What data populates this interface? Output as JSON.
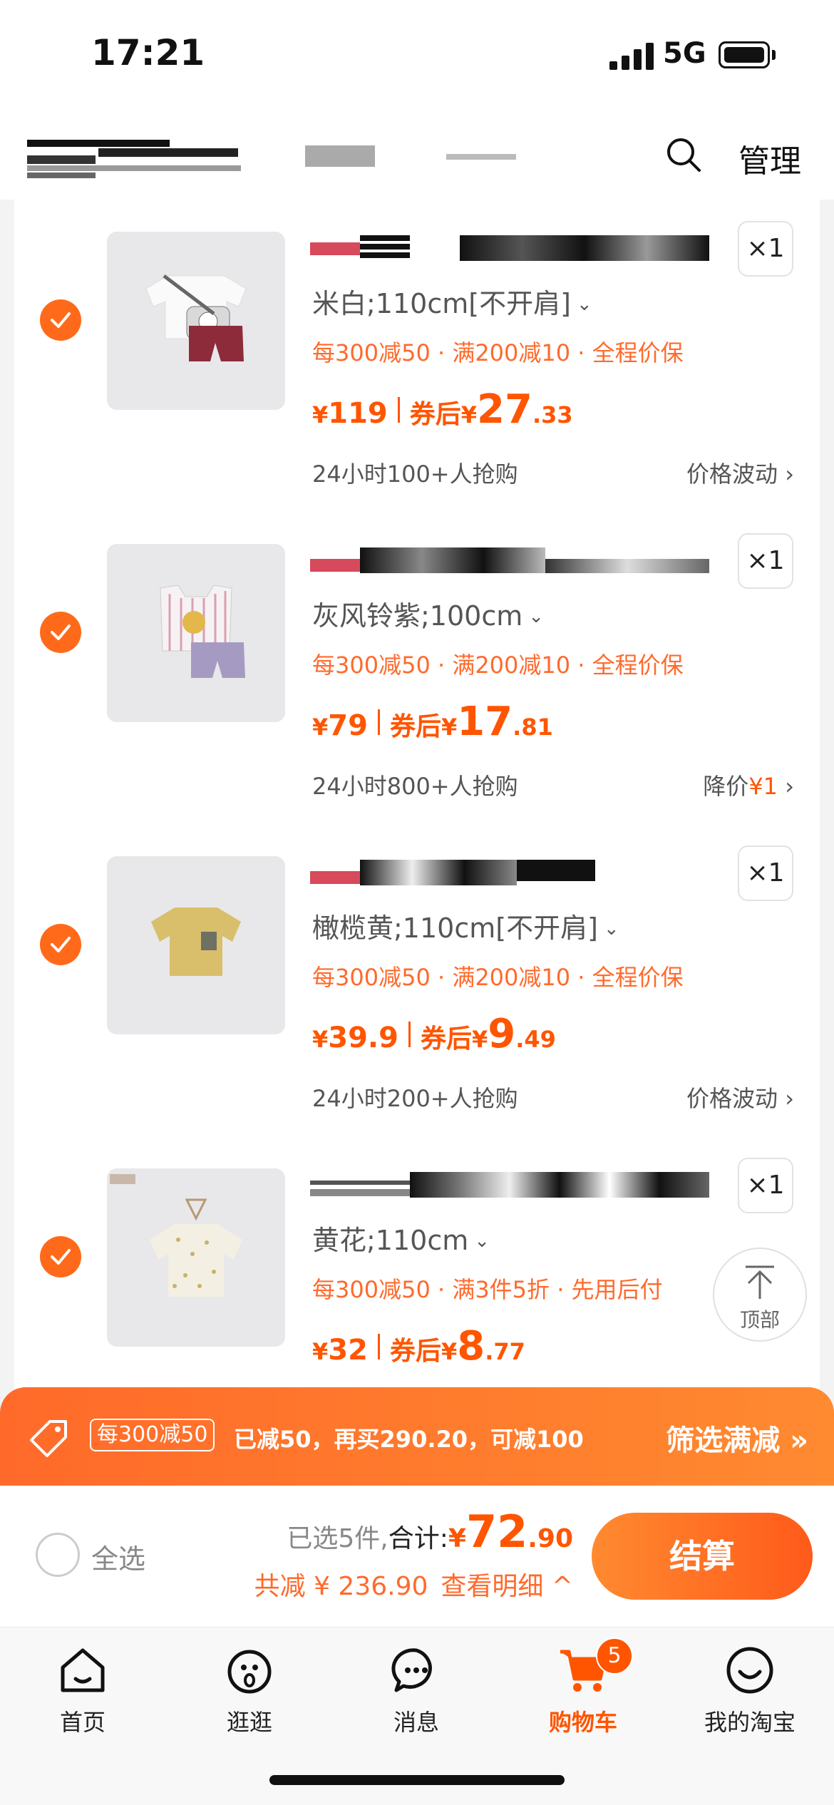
{
  "status": {
    "time": "17:21",
    "network": "5G"
  },
  "nav": {
    "manage_label": "管理"
  },
  "items": [
    {
      "variant": "米白;110cm[不开肩]",
      "promo": "每300减50 · 满200减10 · 全程价保",
      "price": "119",
      "coupon_label": "券后",
      "after_int": "27",
      "after_dec": ".33",
      "hot": "24小时100+人抢购",
      "trend": "价格波动",
      "trend_extra": "",
      "qty": "×1"
    },
    {
      "variant": "灰风铃紫;100cm",
      "promo": "每300减50 · 满200减10 · 全程价保",
      "price": "79",
      "coupon_label": "券后",
      "after_int": "17",
      "after_dec": ".81",
      "hot": "24小时800+人抢购",
      "trend": "降价",
      "trend_extra": "¥1",
      "qty": "×1"
    },
    {
      "variant": "橄榄黄;110cm[不开肩]",
      "promo": "每300减50 · 满200减10 · 全程价保",
      "price": "39.9",
      "coupon_label": "券后",
      "after_int": "9",
      "after_dec": ".49",
      "hot": "24小时200+人抢购",
      "trend": "价格波动",
      "trend_extra": "",
      "qty": "×1"
    },
    {
      "variant": "黄花;110cm",
      "promo": "每300减50 · 满3件5折 · 先用后付",
      "price": "32",
      "coupon_label": "券后",
      "after_int": "8",
      "after_dec": ".77",
      "hot": "",
      "trend": "",
      "trend_extra": "",
      "qty": "×1"
    }
  ],
  "currency": "¥",
  "back_to_top": "顶部",
  "promo_bar": {
    "chip": "每300减50",
    "text": "已减50，再买290.20，可减100",
    "filter": "筛选满减 »"
  },
  "checkout": {
    "select_all": "全选",
    "selected": "已选5件,",
    "total_label": "合计:",
    "total_int": "72",
    "total_dec": ".90",
    "saved": "共减 ¥ 236.90",
    "detail": "查看明细 ^",
    "button": "结算"
  },
  "tabs": [
    {
      "label": "首页",
      "icon": "home-icon"
    },
    {
      "label": "逛逛",
      "icon": "browse-icon"
    },
    {
      "label": "消息",
      "icon": "message-icon"
    },
    {
      "label": "购物车",
      "icon": "cart-icon"
    },
    {
      "label": "我的淘宝",
      "icon": "profile-icon"
    }
  ],
  "cart_badge": "5",
  "colors": {
    "accent": "#ff5500",
    "accent_light": "#ff6a2c",
    "check": "#ff6a1a"
  }
}
